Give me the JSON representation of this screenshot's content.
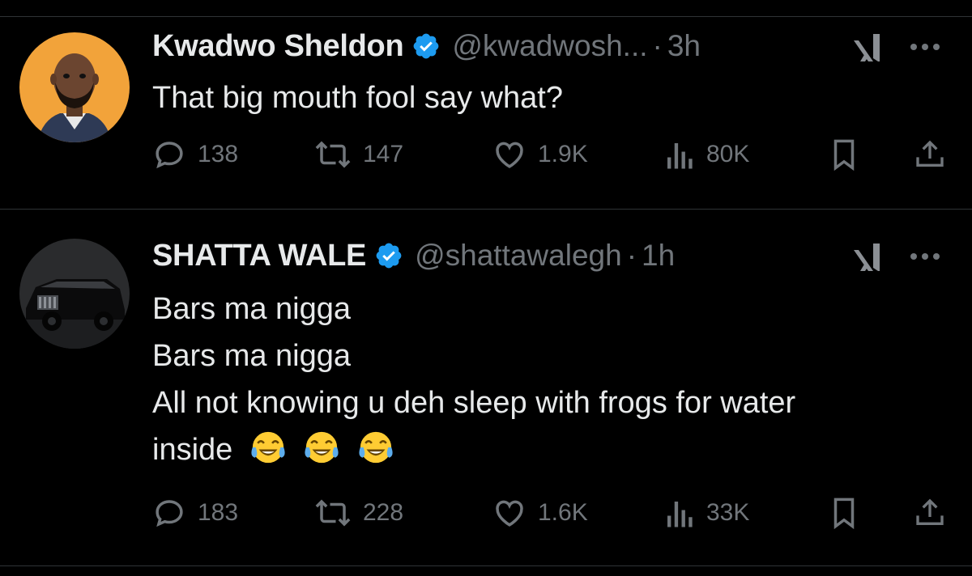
{
  "tweets": [
    {
      "name": "Kwadwo Sheldon",
      "handle": "@kwadwosh...",
      "separator": "·",
      "time": "3h",
      "lines": [
        "That big mouth fool say what?"
      ],
      "emoji_count": 0,
      "avatar": "cartoon-man-avatar",
      "stats": {
        "replies": "138",
        "reposts": "147",
        "likes": "1.9K",
        "views": "80K"
      }
    },
    {
      "name": "SHATTA WALE",
      "handle": "@shattawalegh",
      "separator": "·",
      "time": "1h",
      "lines": [
        "Bars ma nigga",
        "Bars ma nigga",
        "All not knowing u deh sleep with frogs for water",
        "inside"
      ],
      "emoji_count": 3,
      "emoji": "face-with-tears-of-joy",
      "avatar": "black-car-avatar",
      "stats": {
        "replies": "183",
        "reposts": "228",
        "likes": "1.6K",
        "views": "33K"
      }
    }
  ],
  "icons": [
    "verified-badge-icon",
    "grok-icon",
    "more-icon",
    "reply-icon",
    "repost-icon",
    "like-icon",
    "views-icon",
    "bookmark-icon",
    "share-icon"
  ],
  "colors": {
    "background": "#000000",
    "text": "#e7e9ea",
    "muted": "#71767b",
    "verified": "#1d9bf0",
    "divider": "#2f3336",
    "avatar1_bg": "#f2a33a"
  }
}
